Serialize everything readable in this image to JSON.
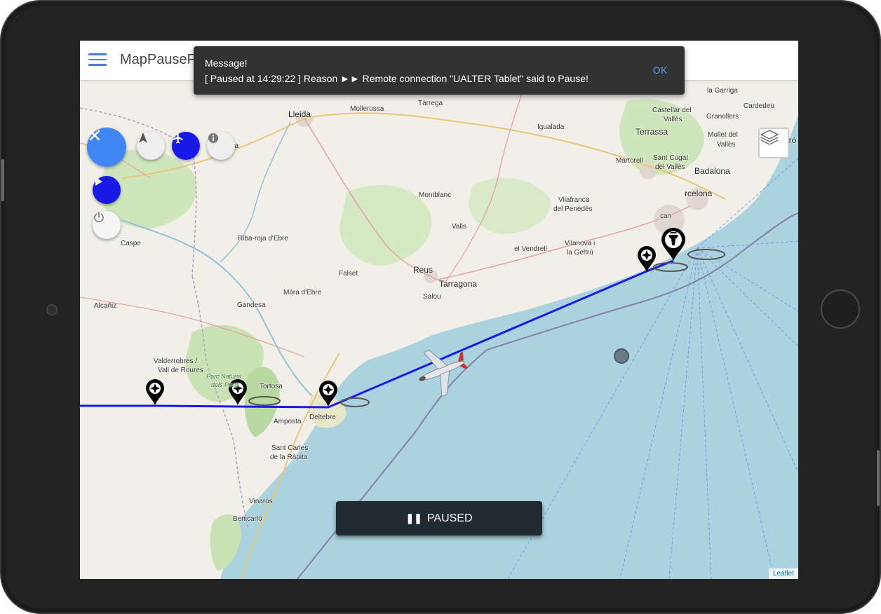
{
  "app": {
    "title": "MapPauseF"
  },
  "toast": {
    "heading": "Message!",
    "body": "[ Paused at 14:29:22 ] Reason ►► Remote connection \"UALTER Tablet\" said to Pause!",
    "ok_label": "OK"
  },
  "paused_button": {
    "label": "PAUSED"
  },
  "attribution": "Leaflet",
  "map": {
    "places": {
      "lleida": "Lleida",
      "mollerussa": "Mollerussa",
      "tarrega": "Tàrrega",
      "igualada": "Igualada",
      "la_garriga": "la Garriga",
      "cardedeu": "Cardedeu",
      "castellar": "Castellar del",
      "valles1": "Vallès",
      "granollers": "Granollers",
      "terrassa": "Terrassa",
      "mollet": "Mollet del",
      "valles2": "Vallès",
      "mataro": "Mataró",
      "martorell": "Martorell",
      "sant_cugat": "Sant Cugat",
      "del_valles": "del Vallès",
      "badalona": "Badalona",
      "barcelona": "rcelona",
      "fraga": "Fraga",
      "montblanc": "Montblanc",
      "vilafranca1": "Vilafranca",
      "vilafranca2": "del Penedès",
      "valls": "Valls",
      "el_vendrell": "el Vendrell",
      "vilanova1": "Vilanova i",
      "vilanova2": "la Geltrú",
      "caspe": "Caspe",
      "ribaroja": "Riba-roja d'Ebre",
      "falset": "Falset",
      "reus": "Reus",
      "tarragona": "Tarragona",
      "mora": "Móra d'Ebre",
      "salou": "Salou",
      "alcaniz": "Alcañiz",
      "gandesa": "Gandesa",
      "valderrobres1": "Valderrobres /",
      "valderrobres2": "Vall de Roures",
      "parc1": "Parc Natural",
      "parc2": "dels Ports",
      "tortosa": "Tortosa",
      "amposta": "Amposta",
      "deltebre": "Deltebre",
      "sant_carles1": "Sant Carles",
      "sant_carles2": "de la Ràpita",
      "vinaros": "Vinaròs",
      "benicarlo": "Benicarló",
      "can": "can"
    }
  },
  "icons": {
    "menu": "hamburger-icon",
    "close": "close-icon",
    "navigate": "navigation-arrow-icon",
    "plane": "airplane-icon",
    "info": "info-icon",
    "play": "play-icon",
    "power": "power-icon",
    "layers": "layers-icon",
    "pause": "pause-icon"
  },
  "colors": {
    "accent_blue": "#4285f4",
    "route_blue": "#1a1ae6",
    "toast_bg": "#323232",
    "ok_link": "#5a9bf6",
    "paused_bg": "#212b33",
    "sea": "#aad3df",
    "land": "#f2efe9"
  }
}
